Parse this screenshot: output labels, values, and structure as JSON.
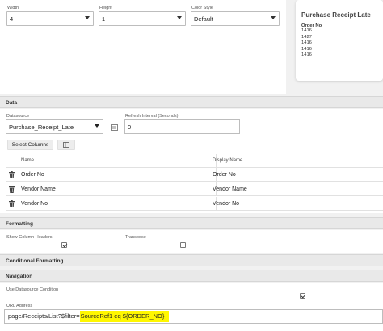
{
  "widget_settings": {
    "width": {
      "label": "Width",
      "value": "4"
    },
    "height": {
      "label": "Height",
      "value": "1"
    },
    "color_style": {
      "label": "Color Style",
      "value": "Default"
    }
  },
  "preview": {
    "title": "Purchase Receipt Late",
    "column_header": "Order No",
    "values": [
      "1416",
      "1427",
      "1416",
      "1416",
      "1416"
    ]
  },
  "data_section": {
    "header": "Data",
    "datasource": {
      "label": "Datasource",
      "value": "Purchase_Receipt_Late"
    },
    "refresh": {
      "label": "Refresh Interval (Seconds)",
      "value": "0"
    },
    "select_columns_label": "Select Columns",
    "table": {
      "headers": [
        "Name",
        "Display Name"
      ],
      "rows": [
        {
          "name": "Order No",
          "display": "Order No"
        },
        {
          "name": "Vendor Name",
          "display": "Vendor Name"
        },
        {
          "name": "Vendor No",
          "display": "Vendor No"
        }
      ]
    }
  },
  "formatting": {
    "header": "Formatting",
    "show_column_headers": {
      "label": "Show Column Headers",
      "checked": true
    },
    "transpose": {
      "label": "Transpose",
      "checked": false
    }
  },
  "conditional_formatting": {
    "header": "Conditional Formatting"
  },
  "navigation": {
    "header": "Navigation",
    "use_datasource_condition": {
      "label": "Use Datasource Condition",
      "checked": true
    },
    "url_label": "URL Address",
    "url_prefix": "page/Receipts/List?$filter=",
    "url_highlighted": "SourceRef1 eq ${ORDER_NO}"
  }
}
